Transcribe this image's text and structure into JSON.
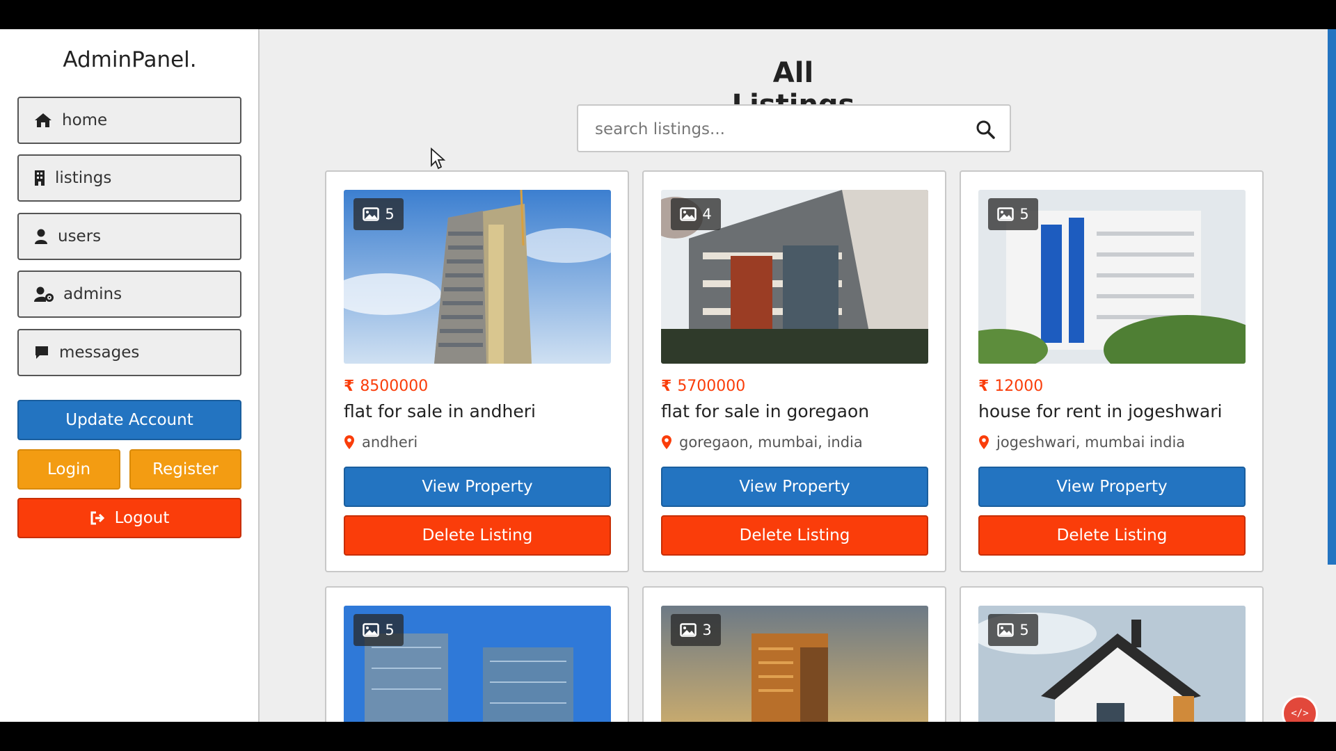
{
  "sidebar": {
    "logo": "AdminPanel.",
    "nav": [
      {
        "label": "home",
        "icon": "home-icon"
      },
      {
        "label": "listings",
        "icon": "building-icon"
      },
      {
        "label": "users",
        "icon": "user-icon"
      },
      {
        "label": "admins",
        "icon": "user-cog-icon"
      },
      {
        "label": "messages",
        "icon": "comment-icon"
      }
    ],
    "update_account": "Update Account",
    "login": "Login",
    "register": "Register",
    "logout": "Logout"
  },
  "main": {
    "title": "All Listings",
    "search_placeholder": "search listings...",
    "listings": [
      {
        "images": "5",
        "price": "8500000",
        "title": "flat for sale in andheri",
        "location": "andheri",
        "view": "View Property",
        "delete": "Delete Listing"
      },
      {
        "images": "4",
        "price": "5700000",
        "title": "flat for sale in goregaon",
        "location": "goregaon, mumbai, india",
        "view": "View Property",
        "delete": "Delete Listing"
      },
      {
        "images": "5",
        "price": "12000",
        "title": "house for rent in jogeshwari",
        "location": "jogeshwari, mumbai india",
        "view": "View Property",
        "delete": "Delete Listing"
      },
      {
        "images": "5"
      },
      {
        "images": "3"
      },
      {
        "images": "5"
      }
    ]
  },
  "colors": {
    "primary_blue": "#2374c1",
    "accent_orange": "#f39c12",
    "danger_red": "#fa3d0a"
  }
}
